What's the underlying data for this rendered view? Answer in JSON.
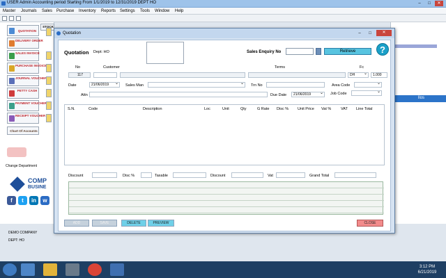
{
  "app": {
    "title": "USER  Admin     Accounting period Starting From   1/1/2019    to   12/31/2019     DEPT  HO",
    "menu": [
      "Master",
      "Journals",
      "Sales",
      "Purchase",
      "Inventory",
      "Reports",
      "Settings",
      "Tools",
      "Window",
      "Help"
    ]
  },
  "sidebar": {
    "buttons": [
      "QUOTATION",
      "STOCK",
      "DELIVERY ORDER",
      "SALES INVOICE",
      "PURCHASE INVOICE",
      "JOURNAL VOUCHER",
      "PETTY CASH",
      "PAYMENT VOUCHER",
      "RECEIPT VOUCHER",
      "Chart Of Accounts"
    ],
    "change_dept": "Change Department",
    "logo_line1": "COMP",
    "logo_line2": "BUSINE",
    "company": "DEMO COMPANY",
    "dept": "DEPT: HO"
  },
  "background": {
    "header_label": "llos"
  },
  "dialog": {
    "title": "Quotation",
    "heading": "Quotation",
    "dept": "Dept: HO",
    "sales_enquiry_label": "Sales Enquiry No",
    "retrieve_label": "Retrieve",
    "help_label": "?",
    "fields": {
      "no_label": "No",
      "no_value": "117",
      "customer_label": "Customer",
      "terms_label": "Terms",
      "fc_label": "Fc",
      "fc_value": "DH",
      "rate_value": "1.000",
      "date_label": "Date",
      "date_value": "21/06/2019",
      "salesman_label": "Sales Man",
      "trn_label": "Trn No",
      "area_label": "Area Code",
      "attn_label": "Attn",
      "due_date_label": "Due Date",
      "due_date_value": "21/06/2019",
      "job_label": "Job Code"
    },
    "columns": [
      "S.N.",
      "Code",
      "Description",
      "Loc",
      "Unit",
      "Qty",
      "G Rate",
      "Disc %",
      "Unit Price",
      "Vat %",
      "VAT",
      "Line Total"
    ],
    "totals": {
      "discount_label": "Discount",
      "disc_pct_label": "Disc %",
      "taxable_label": "Taxable",
      "discount2_label": "Discount",
      "vat_label": "Vat",
      "grand_total_label": "Grand Total"
    },
    "buttons": {
      "add": "ADD",
      "save": "SAVE",
      "delete": "DELETE",
      "preview": "PREVIEW",
      "close": "CLOSE"
    }
  },
  "taskbar": {
    "time": "3:12 PM",
    "date": "6/21/2019"
  }
}
